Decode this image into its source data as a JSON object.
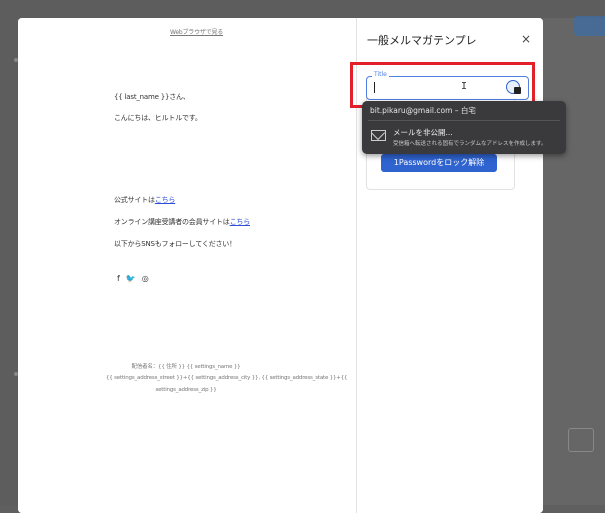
{
  "preview": {
    "top_link": "Webブラウザで見る",
    "greeting": "{{ last_name }}さん、",
    "hello": "こんにちは、ヒルトルです。",
    "site_prefix": "公式サイトは",
    "site_link": "こちら",
    "members_prefix": "オンライン講座受講者の会員サイトは",
    "members_link": "こちら",
    "follow": "以下からSNSもフォローしてください！",
    "social": {
      "facebook": "f",
      "twitter": "🐦",
      "instagram": "◎"
    },
    "footer1": "配信者名：{{ 住所 }} {{ settings_name }}",
    "footer2": "{{ settings_address_street }}+{{ settings_address_city }}, {{ settings_address_state }}+{{",
    "footer3": "settings_address_zip }}"
  },
  "panel": {
    "title": "一般メルマガテンプレ",
    "close": "×",
    "field_label": "Title",
    "field_value": "",
    "unlock_label": "1Passwordをロック解除"
  },
  "popup": {
    "email_row": "bit.pikaru@gmail.com – 白宅",
    "hide_title": "メールを非公開...",
    "hide_subtitle": "受信箱へ転送される固有でランダムなアドレスを作成します。"
  },
  "colors": {
    "accent": "#2f63cf",
    "highlight": "#e2202a",
    "popup_bg": "#3a3a3c"
  }
}
